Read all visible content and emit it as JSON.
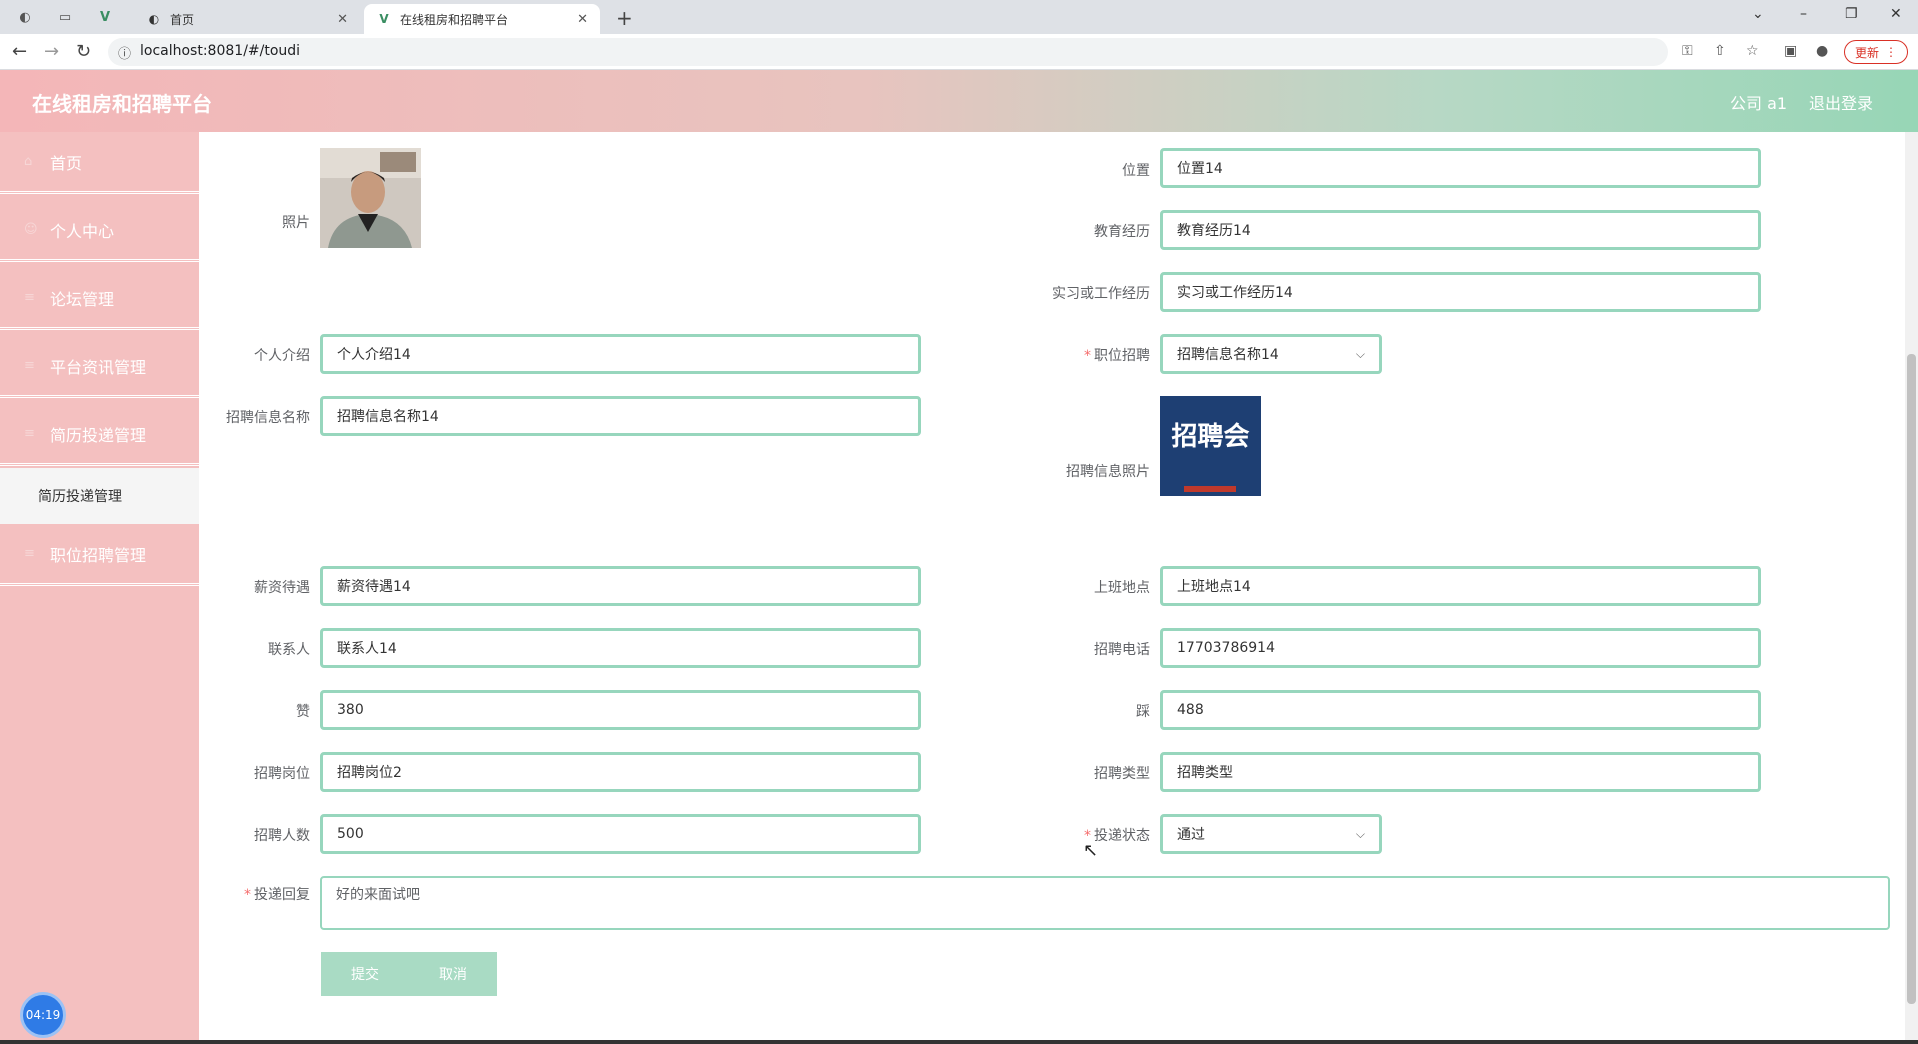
{
  "browser": {
    "tabs": [
      {
        "title": "首页",
        "active": false
      },
      {
        "title": "在线租房和招聘平台",
        "active": true
      }
    ],
    "url": "localhost:8081/#/toudi",
    "update_label": "更新"
  },
  "header": {
    "app_title": "在线租房和招聘平台",
    "user": "公司 a1",
    "logout": "退出登录"
  },
  "sidebar": {
    "items": [
      {
        "label": "首页"
      },
      {
        "label": "个人中心"
      },
      {
        "label": "论坛管理"
      },
      {
        "label": "平台资讯管理"
      },
      {
        "label": "简历投递管理"
      },
      {
        "label": "职位招聘管理"
      }
    ],
    "subitem": "简历投递管理",
    "timer": "04:19"
  },
  "form": {
    "photo_label": "照片",
    "location": {
      "label": "位置",
      "value": "位置14"
    },
    "education": {
      "label": "教育经历",
      "value": "教育经历14"
    },
    "experience": {
      "label": "实习或工作经历",
      "value": "实习或工作经历14"
    },
    "intro": {
      "label": "个人介绍",
      "value": "个人介绍14"
    },
    "job": {
      "label": "职位招聘",
      "value": "招聘信息名称14"
    },
    "job_name": {
      "label": "招聘信息名称",
      "value": "招聘信息名称14"
    },
    "job_photo_label": "招聘信息照片",
    "job_photo_text": "招聘会",
    "salary": {
      "label": "薪资待遇",
      "value": "薪资待遇14"
    },
    "work_place": {
      "label": "上班地点",
      "value": "上班地点14"
    },
    "contact": {
      "label": "联系人",
      "value": "联系人14"
    },
    "phone": {
      "label": "招聘电话",
      "value": "17703786914"
    },
    "likes": {
      "label": "赞",
      "value": "380"
    },
    "dislikes": {
      "label": "踩",
      "value": "488"
    },
    "position": {
      "label": "招聘岗位",
      "value": "招聘岗位2"
    },
    "type": {
      "label": "招聘类型",
      "value": "招聘类型"
    },
    "headcount": {
      "label": "招聘人数",
      "value": "500"
    },
    "status": {
      "label": "投递状态",
      "value": "通过"
    },
    "reply": {
      "label": "投递回复",
      "value": "好的来面试吧"
    },
    "submit": "提交",
    "cancel": "取消"
  },
  "colors": {
    "field_border": "#97d6bd",
    "sidebar_bg": "#f4c0c0",
    "button_bg": "#a9dbc4",
    "required": "#f56c6c"
  }
}
